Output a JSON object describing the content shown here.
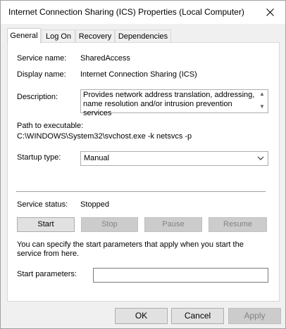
{
  "window": {
    "title": "Internet Connection Sharing (ICS) Properties (Local Computer)"
  },
  "tabs": [
    {
      "label": "General"
    },
    {
      "label": "Log On"
    },
    {
      "label": "Recovery"
    },
    {
      "label": "Dependencies"
    }
  ],
  "general": {
    "service_name_label": "Service name:",
    "service_name": "SharedAccess",
    "display_name_label": "Display name:",
    "display_name": "Internet Connection Sharing (ICS)",
    "description_label": "Description:",
    "description": "Provides network address translation, addressing, name resolution and/or intrusion prevention services",
    "path_label": "Path to executable:",
    "path": "C:\\WINDOWS\\System32\\svchost.exe -k netsvcs -p",
    "startup_type_label": "Startup type:",
    "startup_type": "Manual",
    "service_status_label": "Service status:",
    "service_status": "Stopped",
    "buttons": {
      "start": "Start",
      "stop": "Stop",
      "pause": "Pause",
      "resume": "Resume"
    },
    "info_text": "You can specify the start parameters that apply when you start the service from here.",
    "start_params_label": "Start parameters:",
    "start_params_value": ""
  },
  "dialog_buttons": {
    "ok": "OK",
    "cancel": "Cancel",
    "apply": "Apply"
  }
}
